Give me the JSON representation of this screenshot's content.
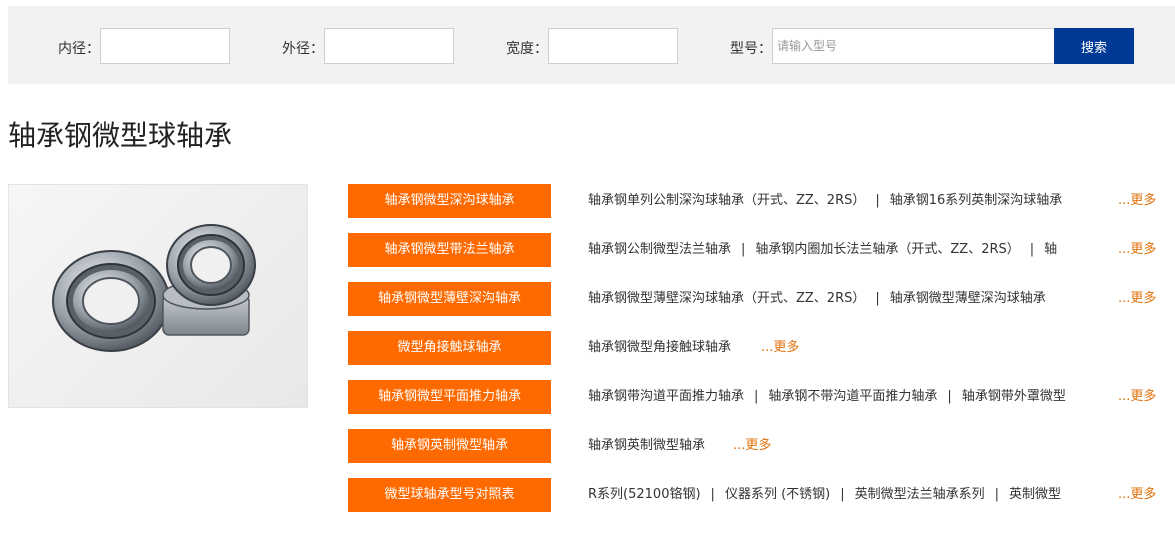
{
  "search": {
    "inner_label": "内径：",
    "inner_value": "",
    "outer_label": "外径：",
    "outer_value": "",
    "width_label": "宽度：",
    "width_value": "",
    "model_label": "型号：",
    "model_placeholder": "请输入型号",
    "model_value": "",
    "button_label": "搜索"
  },
  "page_title": "轴承钢微型球轴承",
  "product_image": {
    "icon": "bearing-photo"
  },
  "categories": [
    {
      "title": "轴承钢微型深沟球轴承",
      "links": [
        "轴承钢单列公制深沟球轴承（开式、ZZ、2RS）",
        "轴承钢16系列英制深沟球轴承"
      ],
      "more": "...更多"
    },
    {
      "title": "轴承钢微型带法兰轴承",
      "links": [
        "轴承钢公制微型法兰轴承",
        "轴承钢内圈加长法兰轴承（开式、ZZ、2RS）",
        "轴"
      ],
      "more": "...更多"
    },
    {
      "title": "轴承钢微型薄壁深沟轴承",
      "links": [
        "轴承钢微型薄壁深沟球轴承（开式、ZZ、2RS）",
        "轴承钢微型薄壁深沟球轴承"
      ],
      "more": "...更多"
    },
    {
      "title": "微型角接触球轴承",
      "links": [
        "轴承钢微型角接触球轴承"
      ],
      "more": "...更多"
    },
    {
      "title": "轴承钢微型平面推力轴承",
      "links": [
        "轴承钢带沟道平面推力轴承",
        "轴承钢不带沟道平面推力轴承",
        "轴承钢带外罩微型"
      ],
      "more": "...更多"
    },
    {
      "title": "轴承钢英制微型轴承",
      "links": [
        "轴承钢英制微型轴承"
      ],
      "more": "...更多"
    },
    {
      "title": "微型球轴承型号对照表",
      "links": [
        "R系列(52100铬钢)",
        "仪器系列 (不锈钢)",
        "英制微型法兰轴承系列",
        "英制微型"
      ],
      "more": "...更多"
    }
  ]
}
